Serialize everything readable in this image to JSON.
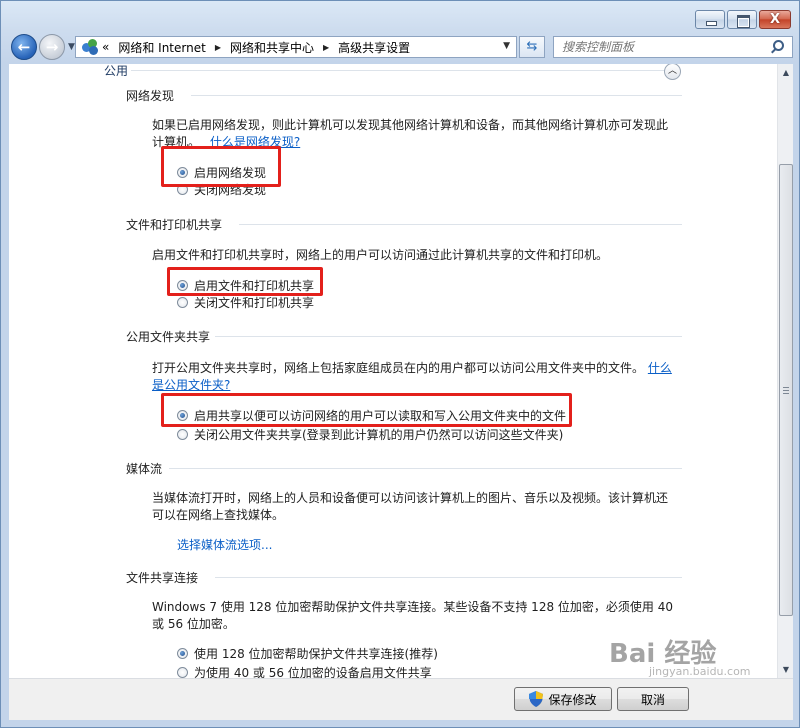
{
  "window": {
    "caption_buttons": {
      "minimize": "—",
      "maximize": "□",
      "close": "X"
    }
  },
  "nav": {
    "back_icon": "arrow-left-icon",
    "forward_icon": "arrow-right-icon",
    "address": {
      "prefix": "«",
      "crumbs": [
        "网络和 Internet",
        "网络和共享中心",
        "高级共享设置"
      ],
      "separator": "▶"
    },
    "search_placeholder": "搜索控制面板"
  },
  "content": {
    "group_title": "公用",
    "sections": [
      {
        "title": "网络发现",
        "description": "如果已启用网络发现，则此计算机可以发现其他网络计算机和设备，而其他网络计算机亦可发现此",
        "description_line2": "计算机。",
        "link": "什么是网络发现?",
        "options": [
          {
            "label": "启用网络发现",
            "selected": true
          },
          {
            "label": "关闭网络发现",
            "selected": false
          }
        ]
      },
      {
        "title": "文件和打印机共享",
        "description": "启用文件和打印机共享时，网络上的用户可以访问通过此计算机共享的文件和打印机。",
        "options": [
          {
            "label": "启用文件和打印机共享",
            "selected": true
          },
          {
            "label": "关闭文件和打印机共享",
            "selected": false
          }
        ]
      },
      {
        "title": "公用文件夹共享",
        "description": "打开公用文件夹共享时，网络上包括家庭组成员在内的用户都可以访问公用文件夹中的文件。",
        "link_part1": "什么",
        "link_part2": "是公用文件夹?",
        "options": [
          {
            "label": "启用共享以便可以访问网络的用户可以读取和写入公用文件夹中的文件",
            "selected": true
          },
          {
            "label": "关闭公用文件夹共享(登录到此计算机的用户仍然可以访问这些文件夹)",
            "selected": false
          }
        ]
      },
      {
        "title": "媒体流",
        "description": "当媒体流打开时，网络上的人员和设备便可以访问该计算机上的图片、音乐以及视频。该计算机还",
        "description_line2": "可以在网络上查找媒体。",
        "link": "选择媒体流选项..."
      },
      {
        "title": "文件共享连接",
        "description": "Windows 7 使用 128 位加密帮助保护文件共享连接。某些设备不支持 128 位加密，必须使用 40",
        "description_line2": "或 56 位加密。",
        "options": [
          {
            "label": "使用 128 位加密帮助保护文件共享连接(推荐)",
            "selected": true
          },
          {
            "label": "为使用 40 或 56 位加密的设备启用文件共享",
            "selected": false
          }
        ]
      }
    ]
  },
  "footer": {
    "save_label": "保存修改",
    "cancel_label": "取消"
  },
  "watermark": {
    "text": "Bai 经验",
    "url": "jingyan.baidu.com"
  },
  "colors": {
    "highlight": "#e3201b",
    "link": "#0b5fc7",
    "group_title": "#1e3a63"
  }
}
